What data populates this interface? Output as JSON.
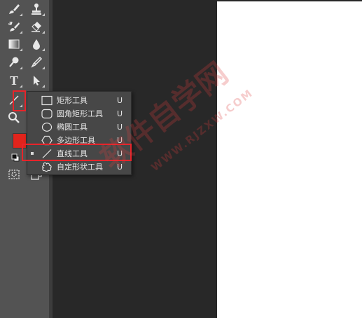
{
  "colors": {
    "foreground": "#e2241c",
    "highlight": "#e8242a",
    "canvas": "#ffffff",
    "toolbar": "#535353"
  },
  "toolbar": {
    "tools": [
      {
        "name": "brush-tool",
        "icon": "brush-icon"
      },
      {
        "name": "clone-stamp-tool",
        "icon": "stamp-icon"
      },
      {
        "name": "history-brush-tool",
        "icon": "history-brush-icon"
      },
      {
        "name": "eraser-tool",
        "icon": "eraser-icon"
      },
      {
        "name": "gradient-tool",
        "icon": "gradient-icon"
      },
      {
        "name": "blur-tool",
        "icon": "drop-icon"
      },
      {
        "name": "dodge-tool",
        "icon": "dodge-icon"
      },
      {
        "name": "pen-tool",
        "icon": "pen-icon"
      },
      {
        "name": "type-tool",
        "icon": "type-icon"
      },
      {
        "name": "path-selection-tool",
        "icon": "arrow-icon"
      },
      {
        "name": "line-tool",
        "icon": "line-icon"
      },
      {
        "name": "zoom-tool",
        "icon": "magnifier-icon"
      },
      {
        "name": "quick-mask",
        "icon": "quick-mask-icon"
      },
      {
        "name": "screen-mode",
        "icon": "screen-mode-icon"
      }
    ],
    "type_glyph": "T"
  },
  "flyout_menu": {
    "items": [
      {
        "icon": "rectangle-icon",
        "label": "矩形工具",
        "shortcut": "U",
        "active": false
      },
      {
        "icon": "rounded-rectangle-icon",
        "label": "圆角矩形工具",
        "shortcut": "U",
        "active": false
      },
      {
        "icon": "ellipse-icon",
        "label": "椭圆工具",
        "shortcut": "U",
        "active": false
      },
      {
        "icon": "polygon-icon",
        "label": "多边形工具",
        "shortcut": "U",
        "active": false
      },
      {
        "icon": "line-icon",
        "label": "直线工具",
        "shortcut": "U",
        "active": true
      },
      {
        "icon": "custom-shape-icon",
        "label": "自定形状工具",
        "shortcut": "U",
        "active": false
      }
    ]
  },
  "watermark": {
    "text_cn": "软件自学网",
    "text_en": "WWW.RJZXW.COM"
  }
}
